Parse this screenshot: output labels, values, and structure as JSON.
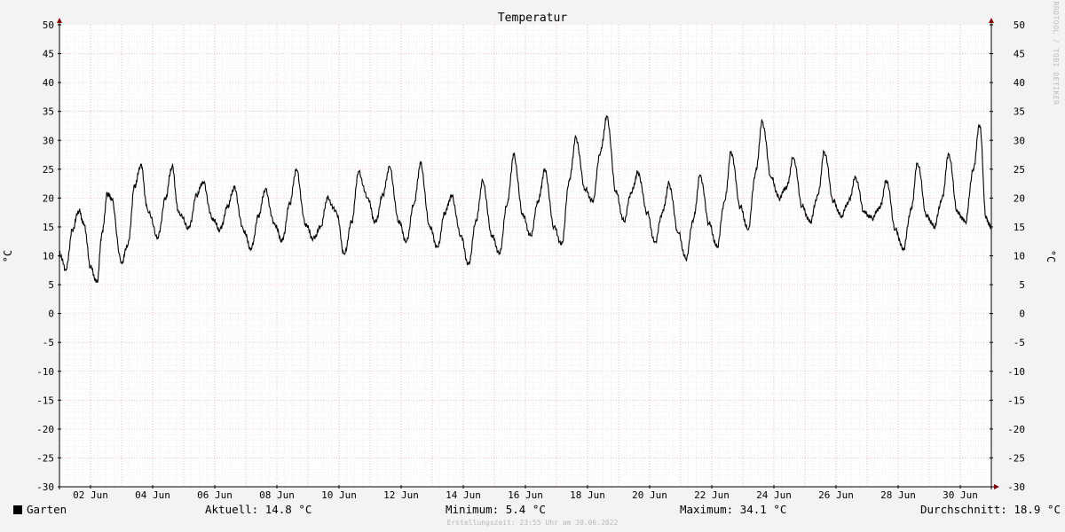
{
  "chart_data": {
    "type": "line",
    "title": "Temperatur",
    "ylabel": "°C",
    "ylim": [
      -30,
      50
    ],
    "yticks": [
      50,
      45,
      40,
      35,
      30,
      25,
      20,
      15,
      10,
      5,
      0,
      -5,
      -10,
      -15,
      -20,
      -25,
      -30
    ],
    "xlim": [
      "2022-06-01",
      "2022-07-01"
    ],
    "xticks": [
      "2022-06-02",
      "2022-06-04",
      "2022-06-06",
      "2022-06-08",
      "2022-06-10",
      "2022-06-12",
      "2022-06-14",
      "2022-06-16",
      "2022-06-18",
      "2022-06-20",
      "2022-06-22",
      "2022-06-24",
      "2022-06-26",
      "2022-06-28",
      "2022-06-30"
    ],
    "xtick_labels": [
      "02 Jun",
      "04 Jun",
      "06 Jun",
      "08 Jun",
      "10 Jun",
      "12 Jun",
      "14 Jun",
      "16 Jun",
      "18 Jun",
      "20 Jun",
      "22 Jun",
      "24 Jun",
      "26 Jun",
      "28 Jun",
      "30 Jun"
    ],
    "grid": true,
    "series": [
      {
        "name": "Garten",
        "color": "#000000",
        "x": [
          "2022-06-01 00:00",
          "2022-06-01 05:00",
          "2022-06-01 10:00",
          "2022-06-01 15:00",
          "2022-06-01 19:00",
          "2022-06-02 00:00",
          "2022-06-02 05:00",
          "2022-06-02 09:00",
          "2022-06-02 13:00",
          "2022-06-02 16:00",
          "2022-06-03 00:00",
          "2022-06-03 05:00",
          "2022-06-03 10:00",
          "2022-06-03 15:00",
          "2022-06-03 20:00",
          "2022-06-04 04:00",
          "2022-06-04 10:00",
          "2022-06-04 15:00",
          "2022-06-04 20:00",
          "2022-06-05 04:00",
          "2022-06-05 10:00",
          "2022-06-05 15:00",
          "2022-06-05 22:00",
          "2022-06-06 04:00",
          "2022-06-06 10:00",
          "2022-06-06 15:00",
          "2022-06-06 22:00",
          "2022-06-07 04:00",
          "2022-06-07 10:00",
          "2022-06-07 15:00",
          "2022-06-07 22:00",
          "2022-06-08 04:00",
          "2022-06-08 10:00",
          "2022-06-08 15:00",
          "2022-06-08 22:00",
          "2022-06-09 04:00",
          "2022-06-09 10:00",
          "2022-06-09 15:00",
          "2022-06-09 22:00",
          "2022-06-10 04:00",
          "2022-06-10 10:00",
          "2022-06-10 15:00",
          "2022-06-10 22:00",
          "2022-06-11 04:00",
          "2022-06-11 10:00",
          "2022-06-11 15:00",
          "2022-06-11 22:00",
          "2022-06-12 04:00",
          "2022-06-12 10:00",
          "2022-06-12 15:00",
          "2022-06-12 22:00",
          "2022-06-13 04:00",
          "2022-06-13 10:00",
          "2022-06-13 15:00",
          "2022-06-13 22:00",
          "2022-06-14 04:00",
          "2022-06-14 10:00",
          "2022-06-14 15:00",
          "2022-06-14 22:00",
          "2022-06-15 04:00",
          "2022-06-15 10:00",
          "2022-06-15 15:00",
          "2022-06-15 22:00",
          "2022-06-16 04:00",
          "2022-06-16 10:00",
          "2022-06-16 15:00",
          "2022-06-16 22:00",
          "2022-06-17 04:00",
          "2022-06-17 10:00",
          "2022-06-17 15:00",
          "2022-06-17 22:00",
          "2022-06-18 04:00",
          "2022-06-18 10:00",
          "2022-06-18 15:00",
          "2022-06-18 22:00",
          "2022-06-19 04:00",
          "2022-06-19 10:00",
          "2022-06-19 15:00",
          "2022-06-19 22:00",
          "2022-06-20 04:00",
          "2022-06-20 10:00",
          "2022-06-20 15:00",
          "2022-06-20 22:00",
          "2022-06-21 04:00",
          "2022-06-21 10:00",
          "2022-06-21 15:00",
          "2022-06-21 22:00",
          "2022-06-22 04:00",
          "2022-06-22 10:00",
          "2022-06-22 15:00",
          "2022-06-22 22:00",
          "2022-06-23 04:00",
          "2022-06-23 10:00",
          "2022-06-23 15:00",
          "2022-06-23 22:00",
          "2022-06-24 04:00",
          "2022-06-24 10:00",
          "2022-06-24 15:00",
          "2022-06-24 22:00",
          "2022-06-25 04:00",
          "2022-06-25 10:00",
          "2022-06-25 15:00",
          "2022-06-25 22:00",
          "2022-06-26 04:00",
          "2022-06-26 10:00",
          "2022-06-26 15:00",
          "2022-06-26 22:00",
          "2022-06-27 04:00",
          "2022-06-27 10:00",
          "2022-06-27 15:00",
          "2022-06-27 22:00",
          "2022-06-28 04:00",
          "2022-06-28 10:00",
          "2022-06-28 15:00",
          "2022-06-28 22:00",
          "2022-06-29 04:00",
          "2022-06-29 10:00",
          "2022-06-29 15:00",
          "2022-06-29 22:00",
          "2022-06-30 04:00",
          "2022-06-30 10:00",
          "2022-06-30 15:00",
          "2022-06-30 20:00",
          "2022-06-30 23:55"
        ],
        "values": [
          10.5,
          7.5,
          14.5,
          17.8,
          15.5,
          8.0,
          5.4,
          14.0,
          20.8,
          20.0,
          8.8,
          12.0,
          22.0,
          25.7,
          18.0,
          13.2,
          20.0,
          25.5,
          17.5,
          14.8,
          20.5,
          22.8,
          16.5,
          14.5,
          18.5,
          21.8,
          14.5,
          11.2,
          17.0,
          21.5,
          15.5,
          12.6,
          19.0,
          25.0,
          15.5,
          13.0,
          15.0,
          20.0,
          17.5,
          10.3,
          16.0,
          24.6,
          20.0,
          15.8,
          20.5,
          25.5,
          16.0,
          12.5,
          19.0,
          26.0,
          15.0,
          11.5,
          17.5,
          20.5,
          13.5,
          8.5,
          16.0,
          23.0,
          13.5,
          10.5,
          19.0,
          27.5,
          17.0,
          13.5,
          19.5,
          25.0,
          15.0,
          12.0,
          23.0,
          30.5,
          21.5,
          19.5,
          28.0,
          34.1,
          21.0,
          16.0,
          21.0,
          24.5,
          17.5,
          12.3,
          17.5,
          22.5,
          14.0,
          9.5,
          16.5,
          24.0,
          15.5,
          11.5,
          19.5,
          28.0,
          18.5,
          14.5,
          24.5,
          33.2,
          23.5,
          20.0,
          22.0,
          27.0,
          18.5,
          15.8,
          20.5,
          28.0,
          19.5,
          16.8,
          19.5,
          23.5,
          17.5,
          16.5,
          18.5,
          23.0,
          14.5,
          11.0,
          18.0,
          26.0,
          17.0,
          15.0,
          20.0,
          27.5,
          17.5,
          15.8,
          25.0,
          32.7,
          16.5,
          14.8
        ]
      }
    ],
    "legend": "bottom-left"
  },
  "right_credit": "RRDTOOL / TOBI OETIKER",
  "legend": {
    "series_label": "Garten",
    "current": "Aktuell: 14.8 °C",
    "minimum": "Minimum: 5.4 °C",
    "maximum": "Maximum: 34.1 °C",
    "average": "Durchschnitt: 18.9 °C"
  },
  "footer": "Erstellungszeit: 23:55 Uhr am 30.06.2022"
}
